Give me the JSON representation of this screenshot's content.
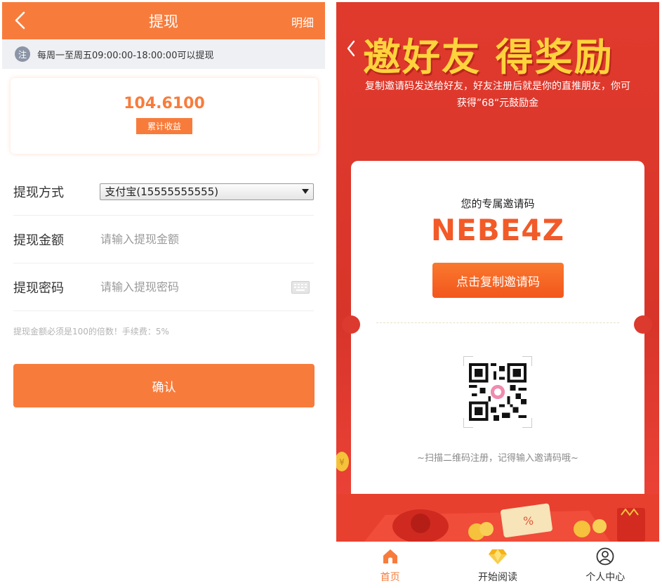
{
  "withdraw": {
    "header": {
      "title": "提现",
      "detail_label": "明细"
    },
    "notice": {
      "badge": "注",
      "text": "每周一至周五09:00:00-18:00:00可以提现"
    },
    "earnings": {
      "amount": "104.6100",
      "label": "累计收益"
    },
    "method": {
      "label": "提现方式",
      "selected": "支付宝(15555555555)"
    },
    "amount_field": {
      "label": "提现金额",
      "placeholder": "请输入提现金额"
    },
    "password_field": {
      "label": "提现密码",
      "placeholder": "请输入提现密码"
    },
    "hint": "提现金额必须是100的倍数！手续费：5%",
    "confirm_label": "确认"
  },
  "invite": {
    "banner": "邀好友 得奖励",
    "subtitle": "复制邀请码发送给好友，好友注册后就是你的直推朋友，你可获得”68“元鼓励金",
    "code_label": "您的专属邀请码",
    "code": "NEBE4Z",
    "copy_button": "点击复制邀请码",
    "scan_tip": "~扫描二维码注册，记得输入邀请码哦~"
  },
  "tabbar": {
    "items": [
      {
        "label": "首页",
        "icon": "home-icon",
        "active": true
      },
      {
        "label": "开始阅读",
        "icon": "diamond-icon",
        "active": false
      },
      {
        "label": "个人中心",
        "icon": "user-icon",
        "active": false
      }
    ]
  },
  "colors": {
    "accent": "#f77c3c",
    "invite_red": "#e03a2d",
    "banner_yellow": "#ffd33c",
    "code_orange": "#f25a28"
  }
}
